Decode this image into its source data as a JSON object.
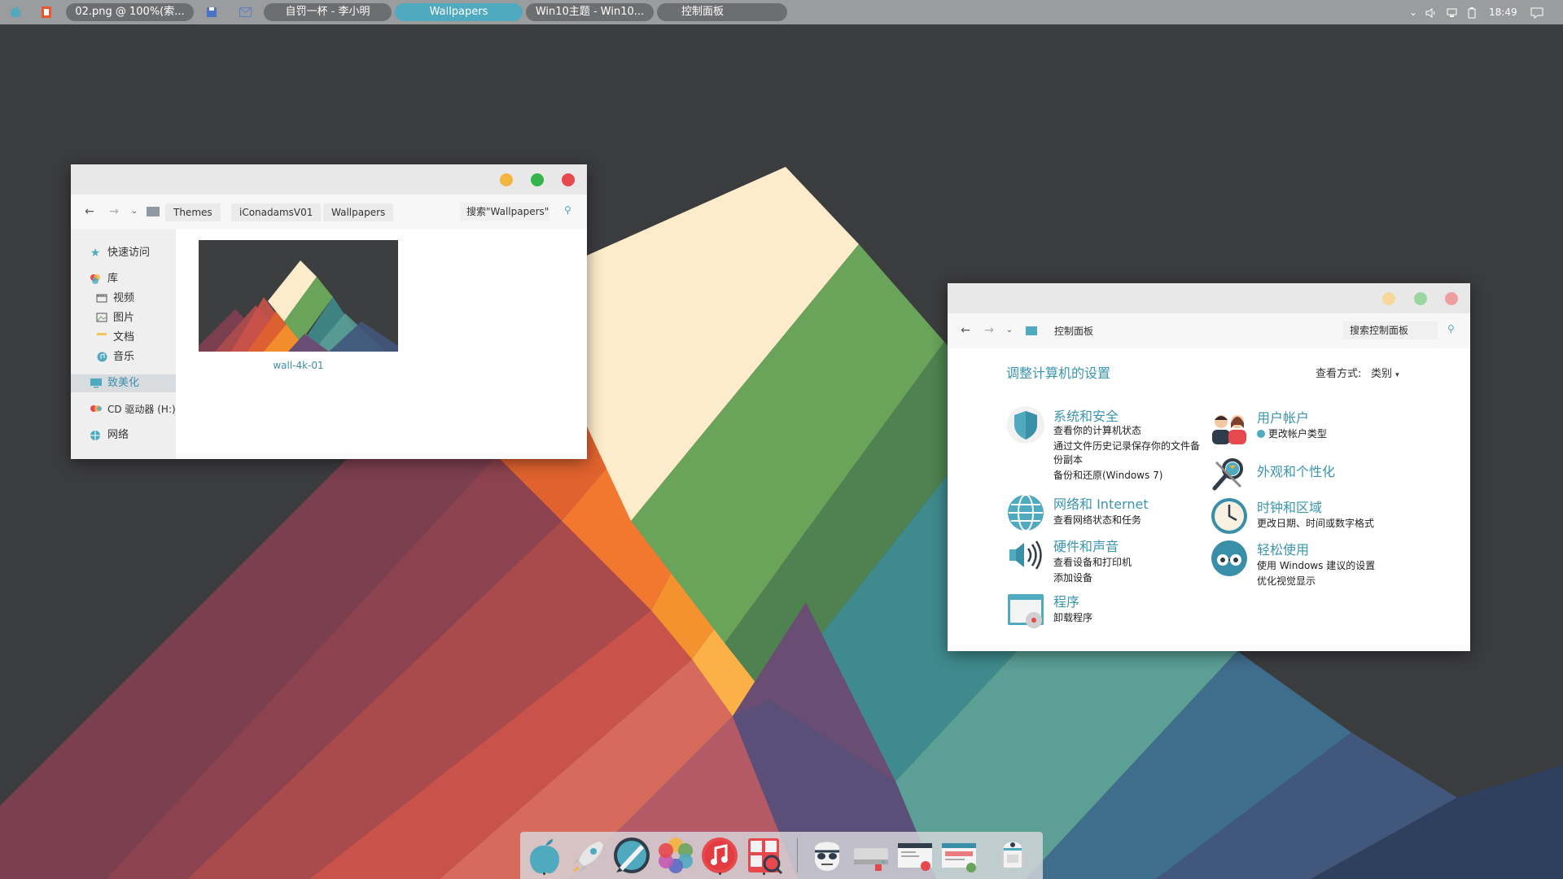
{
  "taskbar": {
    "tasks": [
      {
        "label": "02.png @ 100%(索..."
      },
      {
        "label": "自罚一杯 - 李小明"
      },
      {
        "label": "Wallpapers"
      },
      {
        "label": "Win10主题 - Win10..."
      },
      {
        "label": "控制面板"
      }
    ],
    "time": "18:49"
  },
  "explorer": {
    "breadcrumbs": [
      "Themes",
      "iConadamsV01",
      "Wallpapers"
    ],
    "search_placeholder": "搜索\"Wallpapers\"",
    "sidebar": [
      {
        "label": "快速访问",
        "icon": "star-icon"
      },
      {
        "label": "库",
        "icon": "library-icon"
      },
      {
        "label": "视频",
        "icon": "video-icon"
      },
      {
        "label": "图片",
        "icon": "picture-icon"
      },
      {
        "label": "文档",
        "icon": "document-icon"
      },
      {
        "label": "音乐",
        "icon": "music-icon"
      },
      {
        "label": "致美化",
        "icon": "monitor-icon",
        "selected": true
      },
      {
        "label": "CD 驱动器 (H:)",
        "icon": "cd-drive-icon"
      },
      {
        "label": "网络",
        "icon": "network-icon"
      }
    ],
    "file": {
      "name": "wall-4k-01"
    }
  },
  "control_panel": {
    "breadcrumb": "控制面板",
    "search_placeholder": "搜索控制面板",
    "heading": "调整计算机的设置",
    "view_label": "查看方式:",
    "view_value": "类别",
    "left_items": [
      {
        "title": "系统和安全",
        "icon": "shield-icon",
        "subs": [
          "查看你的计算机状态",
          "通过文件历史记录保存你的文件备",
          "份副本",
          "备份和还原(Windows 7)"
        ]
      },
      {
        "title": "网络和 Internet",
        "icon": "globe-icon",
        "subs": [
          "查看网络状态和任务"
        ]
      },
      {
        "title": "硬件和声音",
        "icon": "speaker-icon",
        "subs": [
          "查看设备和打印机",
          "添加设备"
        ]
      },
      {
        "title": "程序",
        "icon": "programs-icon",
        "subs": [
          "卸载程序"
        ]
      }
    ],
    "right_items": [
      {
        "title": "用户帐户",
        "icon": "users-icon",
        "subs": [
          "更改帐户类型"
        ]
      },
      {
        "title": "外观和个性化",
        "icon": "appearance-icon",
        "subs": []
      },
      {
        "title": "时钟和区域",
        "icon": "clock-icon",
        "subs": [
          "更改日期、时间或数字格式"
        ]
      },
      {
        "title": "轻松使用",
        "icon": "ease-of-access-icon",
        "subs": [
          "使用 Windows 建议的设置",
          "优化视觉显示"
        ]
      }
    ]
  },
  "dock": {
    "apps": [
      "finder-icon",
      "rocket-icon",
      "paintbrush-icon",
      "photos-icon",
      "music-note-icon",
      "photo-booth-icon",
      "stormtrooper-icon",
      "drive-icon",
      "mail-icon",
      "browser-icon",
      "robot-icon"
    ]
  },
  "colors": {
    "accent": "#4fa9bf",
    "link": "#3a95ad",
    "close": "#e5484d",
    "minimize": "#f3b53f",
    "maximize": "#35b44a"
  }
}
